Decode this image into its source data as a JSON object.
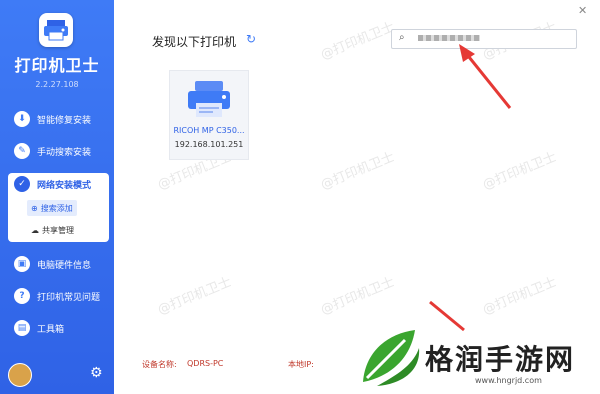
{
  "app": {
    "title": "打印机卫士",
    "version": "2.2.27.108"
  },
  "sidebar": {
    "items": [
      {
        "label": "智能修复安装",
        "icon": "install-icon"
      },
      {
        "label": "手动搜索安装",
        "icon": "wrench-icon"
      },
      {
        "label": "网络安装模式",
        "icon": "shield-icon"
      },
      {
        "label": "电脑硬件信息",
        "icon": "computer-icon"
      },
      {
        "label": "打印机常见问题",
        "icon": "question-icon"
      },
      {
        "label": "工具箱",
        "icon": "toolbox-icon"
      }
    ],
    "sub_items": [
      {
        "label": "搜索添加",
        "icon": "search-plus-icon",
        "active": true
      },
      {
        "label": "共享管理",
        "icon": "cloud-icon",
        "active": false
      }
    ]
  },
  "main": {
    "title": "发现以下打印机",
    "search_value": ""
  },
  "printers": [
    {
      "name": "RICOH MP C350...",
      "ip": "192.168.101.251"
    }
  ],
  "footer": {
    "device_label": "设备名称:",
    "device_value": "QDRS-PC",
    "ip_label": "本地IP:"
  },
  "watermark": "@打印机卫士",
  "brand": {
    "name": "格润手游网",
    "url": "www.hngrjd.com"
  },
  "colors": {
    "accent": "#3f7bf6",
    "sidebar": "#2f62e6",
    "arrow": "#e53935",
    "brand_green": "#3aa52f"
  }
}
